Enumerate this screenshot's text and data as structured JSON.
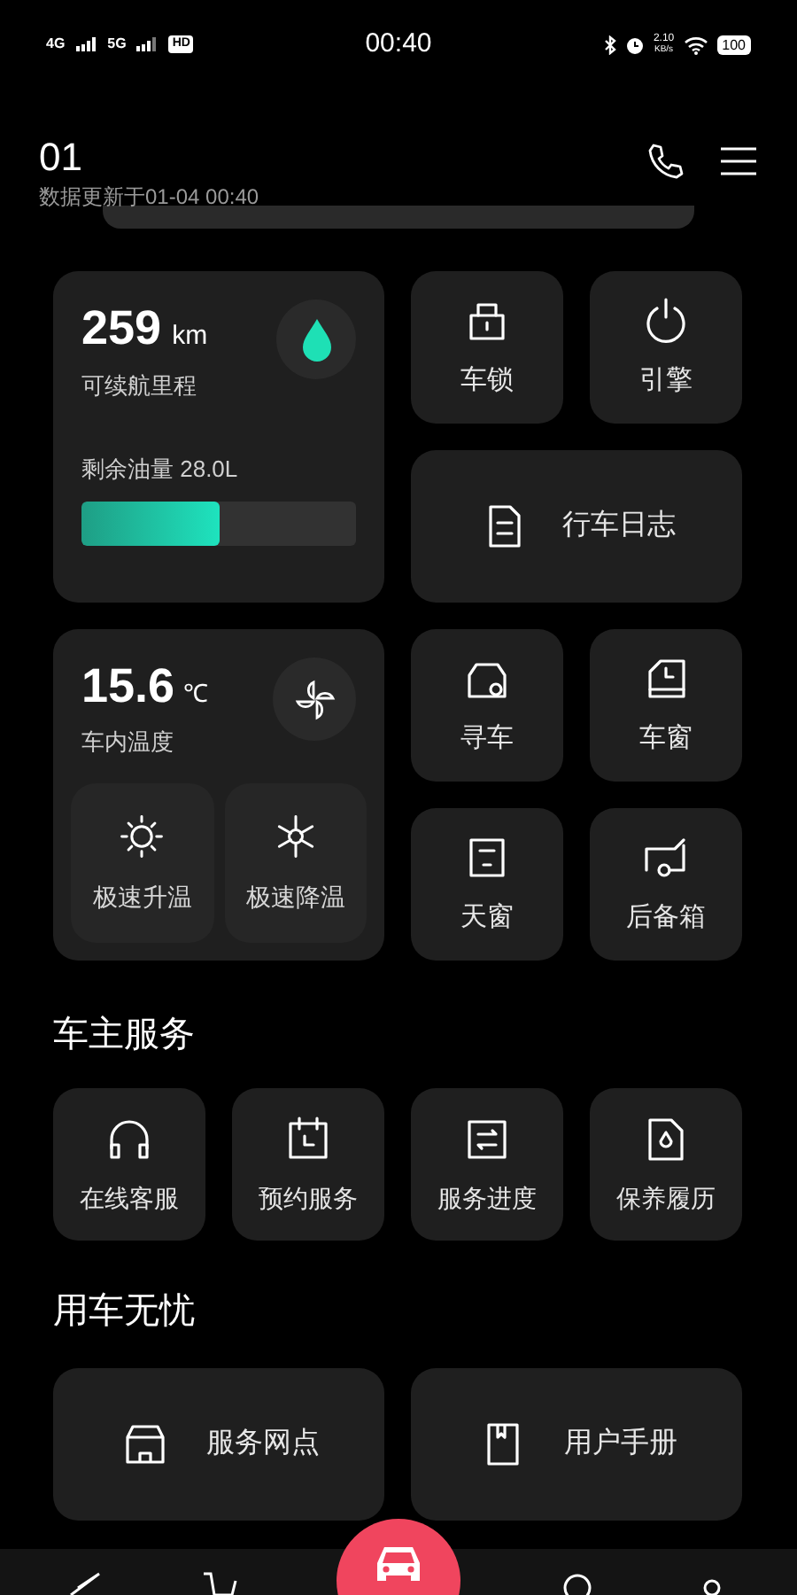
{
  "status_bar": {
    "network_1": "4G",
    "network_2": "5G",
    "hd": "HD",
    "time": "00:40",
    "speed_value": "2.10",
    "speed_unit": "KB/s",
    "battery": "100"
  },
  "header": {
    "title": "01",
    "updated": "数据更新于01-04 00:40"
  },
  "range": {
    "value": "259",
    "unit": "km",
    "label": "可续航里程",
    "fuel_label": "剩余油量 28.0L",
    "level": 0.5
  },
  "temperature": {
    "value": "15.6",
    "unit": "℃",
    "label": "车内温度",
    "buttons": [
      {
        "kind": "heat",
        "label": "极速升温"
      },
      {
        "kind": "cool",
        "label": "极速降温"
      }
    ]
  },
  "controls": [
    {
      "kind": "lock",
      "label": "车锁"
    },
    {
      "kind": "power",
      "label": "引擎"
    },
    {
      "kind": "log",
      "label": "行车日志"
    },
    {
      "kind": "find",
      "label": "寻车"
    },
    {
      "kind": "window",
      "label": "车窗"
    },
    {
      "kind": "sunroof",
      "label": "天窗"
    },
    {
      "kind": "trunk",
      "label": "后备箱"
    }
  ],
  "owner_services": {
    "title": "车主服务",
    "items": [
      {
        "kind": "headset",
        "label": "在线客服"
      },
      {
        "kind": "calendar",
        "label": "预约服务"
      },
      {
        "kind": "progress",
        "label": "服务进度"
      },
      {
        "kind": "maintenance",
        "label": "保养履历"
      }
    ]
  },
  "worry_free": {
    "title": "用车无忧",
    "items": [
      {
        "kind": "store",
        "label": "服务网点"
      },
      {
        "kind": "manual",
        "label": "用户手册"
      }
    ]
  }
}
